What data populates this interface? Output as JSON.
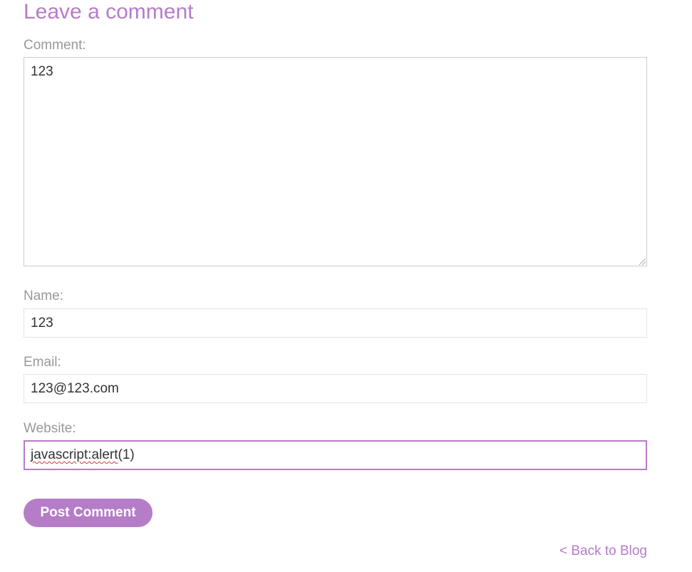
{
  "page": {
    "section_title": "Leave a comment"
  },
  "form": {
    "comment_label": "Comment:",
    "comment_value": "123",
    "name_label": "Name:",
    "name_value": "123",
    "email_label": "Email:",
    "email_value": "123@123.com",
    "website_label": "Website:",
    "website_value": "javascript:alert(1)",
    "website_misspelled": "javascript:alert",
    "website_rest": "(1)",
    "submit_label": "Post Comment"
  },
  "footer": {
    "back_link": "< Back to Blog"
  },
  "colors": {
    "accent": "#b57cc8",
    "label": "#999999",
    "text": "#333333",
    "spellcheck": "#d8363a"
  }
}
